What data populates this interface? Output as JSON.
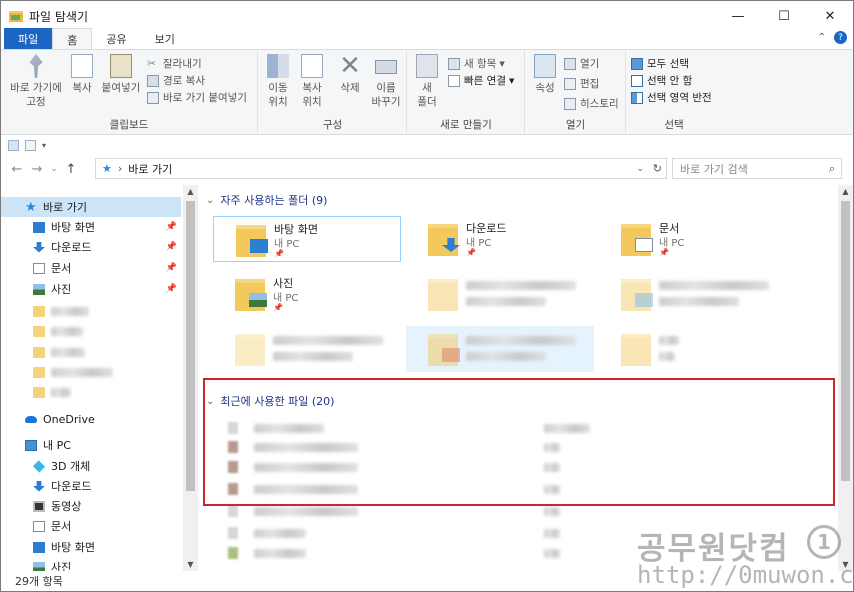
{
  "window": {
    "title": "파일 탐색기"
  },
  "ribbon_tabs": [
    "파일",
    "홈",
    "공유",
    "보기"
  ],
  "ribbon": {
    "clipboard": {
      "label": "클립보드",
      "pin": "바로 가기에\n고정",
      "copy": "복사",
      "paste": "붙여넣기",
      "cut": "잘라내기",
      "copy_path": "경로 복사",
      "paste_shortcut": "바로 가기 붙여넣기"
    },
    "organize": {
      "label": "구성",
      "move": "이동\n위치",
      "copyto": "복사\n위치",
      "delete": "삭제",
      "rename": "이름\n바꾸기"
    },
    "new": {
      "label": "새로 만들기",
      "new_folder": "새\n폴더",
      "new_item": "새 항목",
      "easy_access": "빠른 연결"
    },
    "open": {
      "label": "열기",
      "properties": "속성",
      "open": "열기",
      "edit": "편집",
      "history": "히스토리"
    },
    "select": {
      "label": "선택",
      "all": "모두 선택",
      "none": "선택 안 함",
      "invert": "선택 영역 반전"
    }
  },
  "address": {
    "path": "바로 가기",
    "search_placeholder": "바로 가기 검색"
  },
  "nav": {
    "quick_access": "바로 가기",
    "pinned": [
      "바탕 화면",
      "다운로드",
      "문서",
      "사진"
    ],
    "onedrive": "OneDrive",
    "this_pc": "내 PC",
    "pc_items": [
      "3D 개체",
      "다운로드",
      "동영상",
      "문서",
      "바탕 화면",
      "사진"
    ]
  },
  "frequent": {
    "header": "자주 사용하는 폴더 (9)",
    "tiles": [
      {
        "name": "바탕 화면",
        "sub": "내 PC"
      },
      {
        "name": "다운로드",
        "sub": "내 PC"
      },
      {
        "name": "문서",
        "sub": "내 PC"
      },
      {
        "name": "사진",
        "sub": "내 PC"
      }
    ]
  },
  "recent": {
    "header": "최근에 사용한 파일 (20)"
  },
  "status": {
    "items": "29개 항목"
  },
  "colors": {
    "accent": "#1a66c2",
    "highlight_box": "#d0232a",
    "selection": "#cce4f7"
  }
}
